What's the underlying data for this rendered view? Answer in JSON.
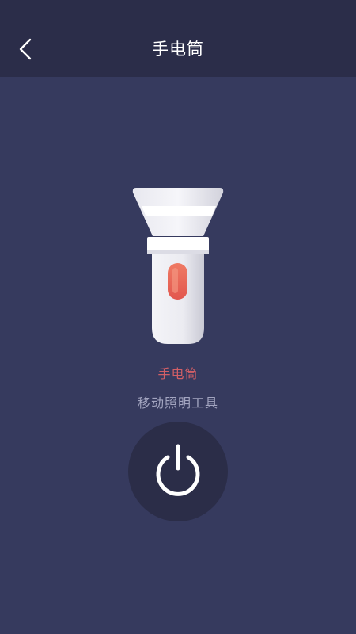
{
  "header": {
    "title": "手电筒",
    "back_icon": "chevron-left-icon"
  },
  "flashlight": {
    "icon": "flashlight-icon",
    "name": "手电筒",
    "description": "移动照明工具"
  },
  "power_button": {
    "icon": "power-icon",
    "state": "off"
  },
  "colors": {
    "background": "#363a5e",
    "header_background": "#2b2d49",
    "accent": "#d25f66",
    "secondary_text": "#a3a5c0",
    "button_background": "#2b2d48"
  }
}
